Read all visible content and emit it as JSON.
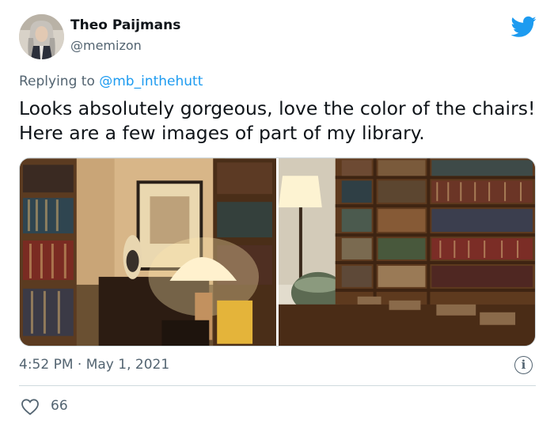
{
  "author": {
    "name": "Theo Paijmans",
    "handle": "@memizon"
  },
  "reply": {
    "prefix": "Replying to ",
    "mention": "@mb_inthehutt"
  },
  "tweet": {
    "text": "Looks absolutely gorgeous, love the color of the chairs! Here are a few images of part of my library."
  },
  "meta": {
    "time": "4:52 PM",
    "separator": " · ",
    "date": "May 1, 2021"
  },
  "engagement": {
    "likes": "66"
  },
  "icons": {
    "brand": "twitter-bird-icon",
    "info": "info-icon",
    "like": "heart-icon"
  },
  "colors": {
    "brand": "#1d9bf0",
    "secondary_text": "#536471",
    "primary_text": "#0f1419"
  }
}
